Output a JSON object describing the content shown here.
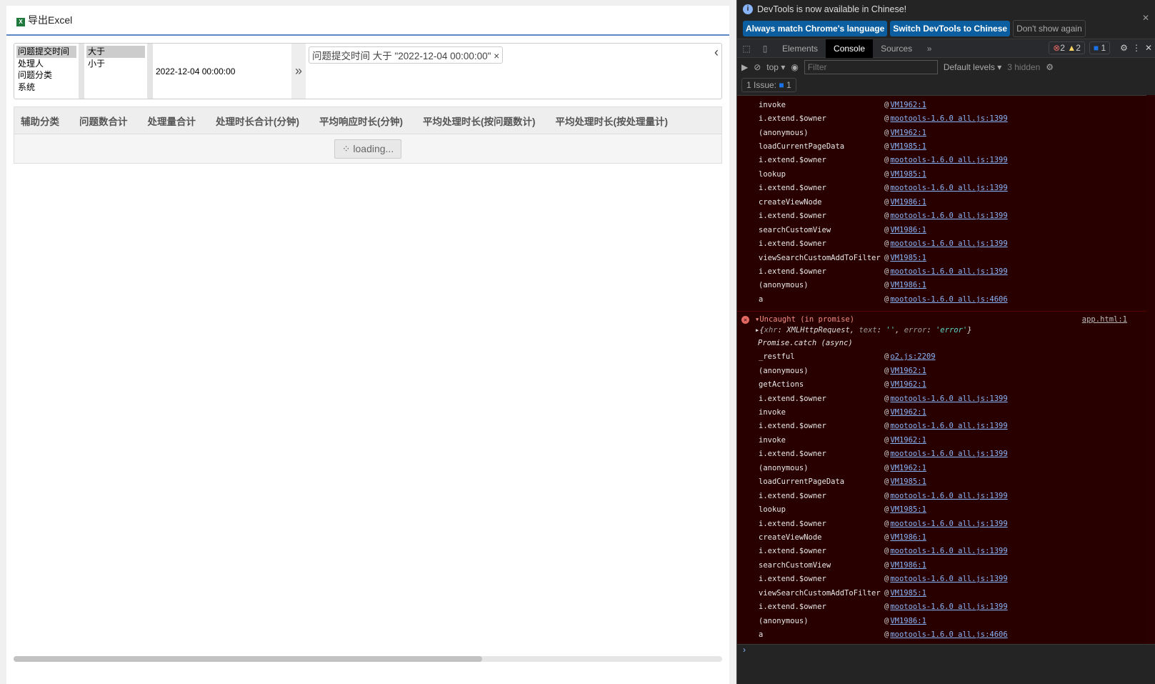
{
  "toolbar": {
    "export_label": "导出Excel",
    "export_icon": "excel-icon"
  },
  "filter": {
    "fields": [
      "问题提交时间",
      "处理人",
      "问题分类",
      "系统"
    ],
    "selected_field": "问题提交时间",
    "operators": [
      "大于",
      "小于"
    ],
    "selected_operator": "大于",
    "value": "2022-12-04 00:00:00",
    "add_icon": "»",
    "tags": [
      {
        "label": "问题提交时间 大于 \"2022-12-04 00:00:00\"",
        "close": "×"
      }
    ],
    "collapse_icon": "‹"
  },
  "grid": {
    "columns": [
      "辅助分类",
      "问题数合计",
      "处理量合计",
      "处理时长合计(分钟)",
      "平均响应时长(分钟)",
      "平均处理时长(按问题数计)",
      "平均处理时长(按处理量计)"
    ],
    "loading": "loading..."
  },
  "devtools": {
    "info": "DevTools is now available in Chinese!",
    "btn_match": "Always match Chrome's language",
    "btn_switch": "Switch DevTools to Chinese",
    "btn_dont": "Don't show again",
    "tabs": [
      "Elements",
      "Console",
      "Sources"
    ],
    "active_tab": "Console",
    "errors": "2",
    "warnings": "2",
    "messages": "1",
    "context": "top",
    "filter_placeholder": "Filter",
    "levels": "Default levels",
    "hidden": "3 hidden",
    "issues_label": "1 Issue:",
    "issues_count": "1",
    "stack1": [
      [
        "invoke",
        "VM1962:1"
      ],
      [
        "i.extend.$owner",
        "mootools-1.6.0 all.js:1399"
      ],
      [
        "(anonymous)",
        "VM1962:1"
      ],
      [
        "loadCurrentPageData",
        "VM1985:1"
      ],
      [
        "i.extend.$owner",
        "mootools-1.6.0 all.js:1399"
      ],
      [
        "lookup",
        "VM1985:1"
      ],
      [
        "i.extend.$owner",
        "mootools-1.6.0 all.js:1399"
      ],
      [
        "createViewNode",
        "VM1986:1"
      ],
      [
        "i.extend.$owner",
        "mootools-1.6.0 all.js:1399"
      ],
      [
        "searchCustomView",
        "VM1986:1"
      ],
      [
        "i.extend.$owner",
        "mootools-1.6.0 all.js:1399"
      ],
      [
        "viewSearchCustomAddToFilter",
        "VM1985:1"
      ],
      [
        "i.extend.$owner",
        "mootools-1.6.0 all.js:1399"
      ],
      [
        "(anonymous)",
        "VM1986:1"
      ],
      [
        "a",
        "mootools-1.6.0 all.js:4606"
      ]
    ],
    "error": {
      "title": "Uncaught (in promise)",
      "source": "app.html:1",
      "obj_open": "{",
      "k1": "xhr",
      "v1": "XMLHttpRequest",
      "k2": "text",
      "v2": "''",
      "k3": "error",
      "v3": "'error'",
      "obj_close": "}",
      "async": "Promise.catch (async)"
    },
    "stack2": [
      [
        "_restful",
        "o2.js:2209"
      ],
      [
        "(anonymous)",
        "VM1962:1"
      ],
      [
        "getActions",
        "VM1962:1"
      ],
      [
        "i.extend.$owner",
        "mootools-1.6.0 all.js:1399"
      ],
      [
        "invoke",
        "VM1962:1"
      ],
      [
        "i.extend.$owner",
        "mootools-1.6.0 all.js:1399"
      ],
      [
        "invoke",
        "VM1962:1"
      ],
      [
        "i.extend.$owner",
        "mootools-1.6.0 all.js:1399"
      ],
      [
        "(anonymous)",
        "VM1962:1"
      ],
      [
        "loadCurrentPageData",
        "VM1985:1"
      ],
      [
        "i.extend.$owner",
        "mootools-1.6.0 all.js:1399"
      ],
      [
        "lookup",
        "VM1985:1"
      ],
      [
        "i.extend.$owner",
        "mootools-1.6.0 all.js:1399"
      ],
      [
        "createViewNode",
        "VM1986:1"
      ],
      [
        "i.extend.$owner",
        "mootools-1.6.0 all.js:1399"
      ],
      [
        "searchCustomView",
        "VM1986:1"
      ],
      [
        "i.extend.$owner",
        "mootools-1.6.0 all.js:1399"
      ],
      [
        "viewSearchCustomAddToFilter",
        "VM1985:1"
      ],
      [
        "i.extend.$owner",
        "mootools-1.6.0 all.js:1399"
      ],
      [
        "(anonymous)",
        "VM1986:1"
      ],
      [
        "a",
        "mootools-1.6.0 all.js:4606"
      ]
    ],
    "prompt": "›"
  }
}
